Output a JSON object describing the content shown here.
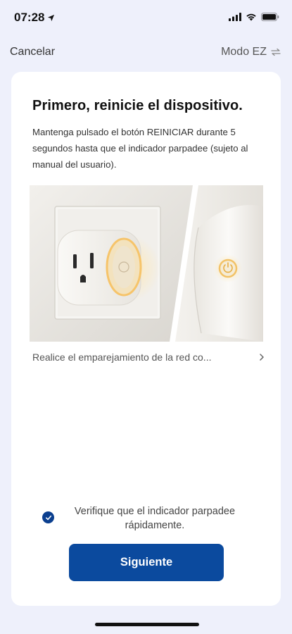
{
  "status_bar": {
    "time": "07:28"
  },
  "nav": {
    "cancel_label": "Cancelar",
    "mode_label": "Modo EZ"
  },
  "card": {
    "title": "Primero, reinicie el dispositivo.",
    "description": "Mantenga pulsado el botón REINICIAR durante 5 segundos hasta que el indicador parpadee (sujeto al manual del usuario).",
    "pairing_link": "Realice el emparejamiento de la red co...",
    "verify_text": "Verifique que el indicador parpadee rápidamente.",
    "next_label": "Siguiente"
  },
  "colors": {
    "accent": "#0b4a9e",
    "background": "#eef0fb"
  }
}
